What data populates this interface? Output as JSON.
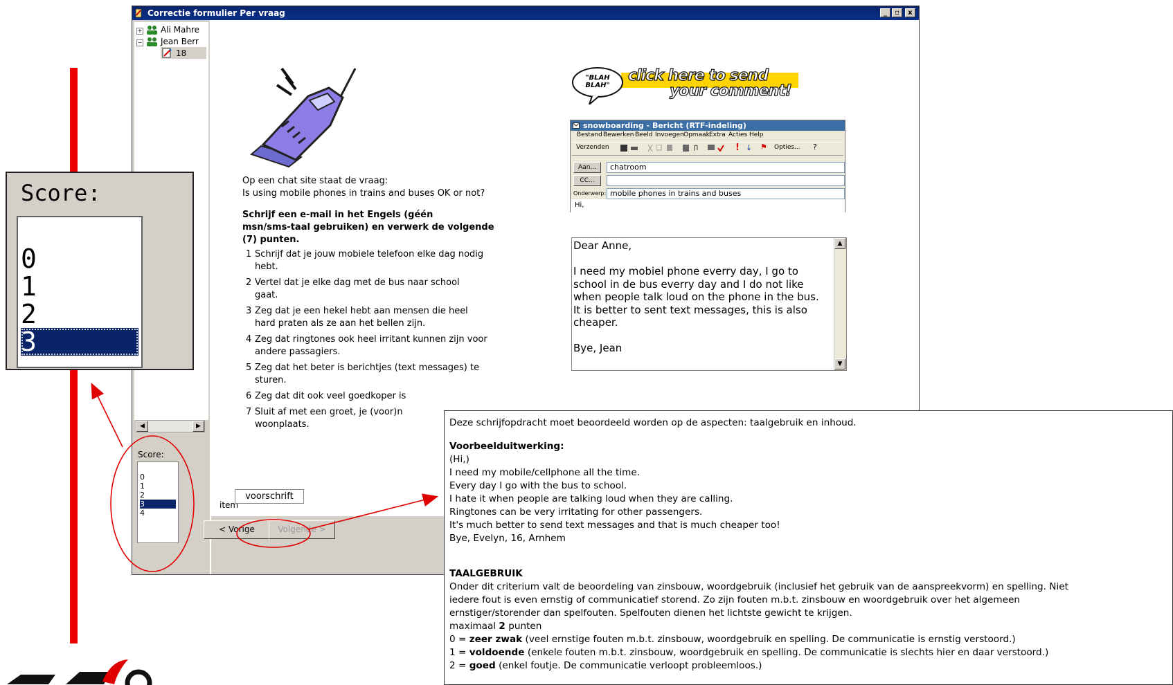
{
  "window": {
    "title": "Correctie formulier Per vraag",
    "controls": [
      "_",
      "▫",
      "x"
    ]
  },
  "tree": {
    "items": [
      {
        "label": "Ali Mahre",
        "icon": "users-icon",
        "expander": "+"
      },
      {
        "label": "Jean Berr",
        "icon": "users-icon",
        "expander": "−"
      },
      {
        "label": "18",
        "icon": "form-edit-icon"
      }
    ]
  },
  "score": {
    "label": "Score:",
    "options": [
      "0",
      "1",
      "2",
      "3",
      "4"
    ],
    "selected": "3"
  },
  "zoom_score": {
    "label": "Score:",
    "options": [
      "0",
      "1",
      "2",
      "3"
    ],
    "selected": "3"
  },
  "question": {
    "intro": [
      "Op een chat site staat de vraag:",
      "Is using mobile phones in trains and buses OK or not?"
    ],
    "instruction": [
      "Schrijf een e-mail in het Engels (géén",
      "msn/sms-taal gebruiken) en verwerk de volgende",
      "(7) punten."
    ],
    "points": [
      {
        "num": "1",
        "lines": [
          "Schrijf dat je jouw mobiele telefoon elke dag nodig",
          "hebt."
        ]
      },
      {
        "num": "2",
        "lines": [
          "Vertel dat je elke dag met de bus naar school",
          "gaat."
        ]
      },
      {
        "num": "3",
        "lines": [
          "Zeg dat je een hekel hebt aan mensen die heel",
          "hard praten als ze aan het bellen zijn."
        ]
      },
      {
        "num": "4",
        "lines": [
          "Zeg dat ringtones ook heel irritant kunnen zijn voor",
          "andere passagiers."
        ]
      },
      {
        "num": "5",
        "lines": [
          "Zeg dat het beter is berichtjes (text messages) te",
          "sturen."
        ]
      },
      {
        "num": "6",
        "lines": [
          "Zeg dat dit ook veel goedkoper is"
        ]
      },
      {
        "num": "7",
        "lines": [
          "Sluit af met een groet, je (voor)n",
          "woonplaats."
        ]
      }
    ]
  },
  "banner": {
    "bubble": "\"BLAH BLAH\"",
    "line1": "click here to send",
    "line2": "your comment!"
  },
  "email": {
    "title": "snowboarding - Bericht (RTF-indeling)",
    "menu": [
      "Bestand",
      "Bewerken",
      "Beeld",
      "Invoegen",
      "Opmaak",
      "Extra",
      "Acties",
      "Help"
    ],
    "send_label": "Verzenden",
    "options_label": "Opties...",
    "aan_label": "Aan...",
    "cc_label": "CC...",
    "subject_label": "Onderwerp:",
    "to": "chatroom",
    "cc": "",
    "subject": "mobile phones in trains and buses",
    "body": "Hi,"
  },
  "answer": {
    "text": "Dear Anne,\n\nI need my mobiel phone everry day, I go to\nschool in de bus everry day and I do not like\nwhen people talk loud on the phone in the bus.\nIt is better to sent text messages, this is also\ncheaper.\n\nBye, Jean"
  },
  "tabs": {
    "item": "item",
    "voorschrift": "voorschrift"
  },
  "nav": {
    "prev": "< Vorige",
    "next": "Volgende >"
  },
  "voorschrift": {
    "line1": "Deze schrijfopdracht moet beoordeeld worden op de aspecten: taalgebruik en inhoud.",
    "heading1": "Voorbeelduitwerking:",
    "example": [
      "(Hi,)",
      "I need my mobile/cellphone all the time.",
      "Every day I go with the bus to school.",
      "I hate it when people are talking loud when they are calling.",
      "Ringtones can be very irritating for other passengers.",
      "It's much better to send text messages and that is much cheaper too!",
      "Bye, Evelyn, 16, Arnhem"
    ],
    "heading2": "TAALGEBRUIK",
    "criteria": [
      "Onder dit criterium valt de beoordeling van zinsbouw, woordgebruik (inclusief het gebruik van de aanspreekvorm) en spelling. Niet",
      "iedere fout is even ernstig of communicatief storend. Zo zijn fouten m.b.t. zinsbouw en woordgebruik over het algemeen",
      "ernstiger/storender dan spelfouten. Spelfouten dienen het lichtste gewicht te krijgen."
    ],
    "max_prefix": "maximaal",
    "max_value": "2",
    "max_suffix": "punten",
    "scores": [
      {
        "prefix": "0 =",
        "grade": "zeer zwak",
        "desc": "(veel ernstige fouten m.b.t. zinsbouw, woordgebruik en spelling. De communicatie is ernstig verstoord.)"
      },
      {
        "prefix": "1 =",
        "grade": "voldoende",
        "desc": "(enkele fouten m.b.t. zinsbouw, woordgebruik en spelling. De communicatie is slechts hier en daar verstoord.)"
      },
      {
        "prefix": "2 =",
        "grade": "goed",
        "desc": "(enkel foutje. De communicatie verloopt probleemloos.)"
      }
    ]
  },
  "colors": {
    "accent": "#0a246a",
    "annotation": "#e00000",
    "banner_yellow": "#ffd400"
  }
}
